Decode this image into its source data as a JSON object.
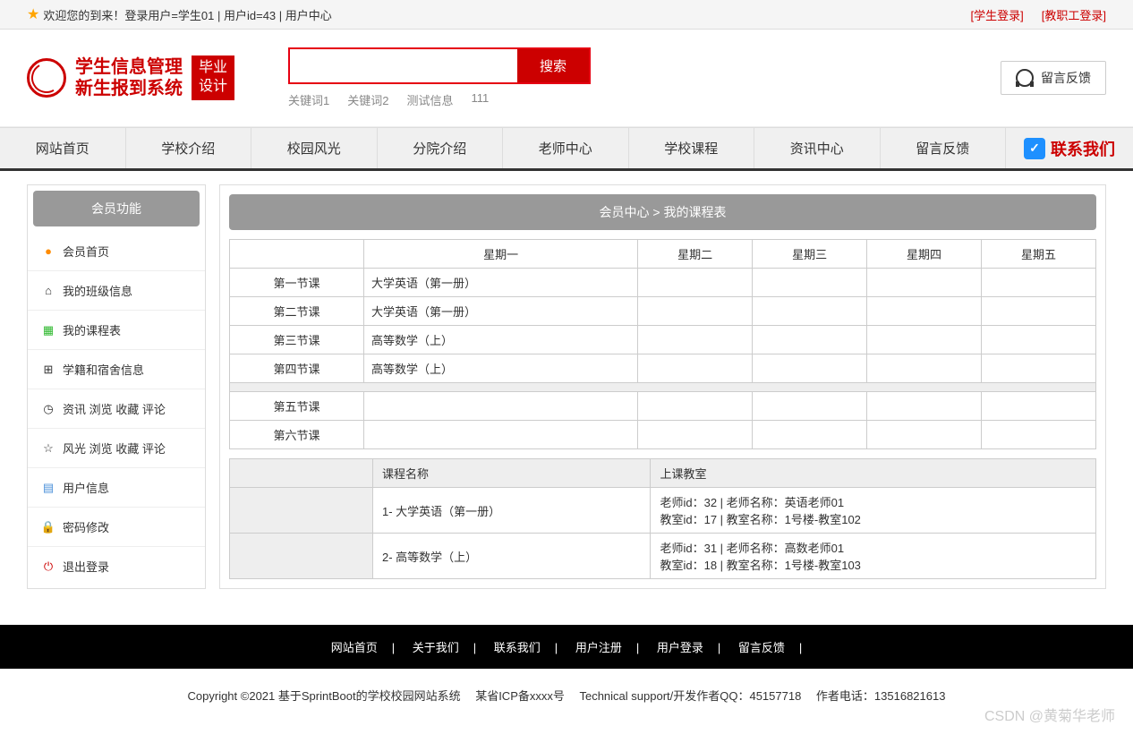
{
  "topBar": {
    "welcome": "欢迎您的到来！登录用户=学生01 | 用户id=43 | 用户中心",
    "studentLogin": "[学生登录]",
    "staffLogin": "[教职工登录]"
  },
  "header": {
    "logoLine1": "学生信息管理",
    "logoLine2": "新生报到系统",
    "badge1": "毕业",
    "badge2": "设计",
    "searchBtn": "搜索",
    "keywords": [
      "关键词1",
      "关键词2",
      "测试信息",
      "111"
    ],
    "feedbackBtn": "留言反馈"
  },
  "nav": {
    "items": [
      "网站首页",
      "学校介绍",
      "校园风光",
      "分院介绍",
      "老师中心",
      "学校课程",
      "资讯中心",
      "留言反馈"
    ],
    "contact": "联系我们"
  },
  "sidebar": {
    "title": "会员功能",
    "items": [
      {
        "label": "会员首页",
        "icon": "●",
        "cls": "icon-orange"
      },
      {
        "label": "我的班级信息",
        "icon": "⌂",
        "cls": ""
      },
      {
        "label": "我的课程表",
        "icon": "▦",
        "cls": "icon-green"
      },
      {
        "label": "学籍和宿舍信息",
        "icon": "⊞",
        "cls": ""
      },
      {
        "label": "资讯 浏览 收藏 评论",
        "icon": "◷",
        "cls": ""
      },
      {
        "label": "风光 浏览 收藏 评论",
        "icon": "☆",
        "cls": ""
      },
      {
        "label": "用户信息",
        "icon": "▤",
        "cls": "icon-blue"
      },
      {
        "label": "密码修改",
        "icon": "🔒",
        "cls": "icon-orange"
      },
      {
        "label": "退出登录",
        "icon": "⏻",
        "cls": "icon-red"
      }
    ]
  },
  "content": {
    "breadcrumb": "会员中心 > 我的课程表",
    "days": [
      "星期一",
      "星期二",
      "星期三",
      "星期四",
      "星期五"
    ],
    "periods": [
      {
        "name": "第一节课",
        "mon": "大学英语（第一册）"
      },
      {
        "name": "第二节课",
        "mon": "大学英语（第一册）"
      },
      {
        "name": "第三节课",
        "mon": "高等数学（上）"
      },
      {
        "name": "第四节课",
        "mon": "高等数学（上）"
      }
    ],
    "periods2": [
      {
        "name": "第五节课"
      },
      {
        "name": "第六节课"
      }
    ],
    "courseHeader": {
      "name": "课程名称",
      "room": "上课教室"
    },
    "courses": [
      {
        "name": "1- 大学英语（第一册）",
        "teacher": "老师id：32 | 老师名称：英语老师01",
        "room": "教室id：17 | 教室名称：1号楼-教室102"
      },
      {
        "name": "2- 高等数学（上）",
        "teacher": "老师id：31 | 老师名称：高数老师01",
        "room": "教室id：18 | 教室名称：1号楼-教室103"
      }
    ]
  },
  "footer": {
    "links": [
      "网站首页",
      "关于我们",
      "联系我们",
      "用户注册",
      "用户登录",
      "留言反馈"
    ],
    "copyright": "Copyright ©2021 基于SprintBoot的学校校园网站系统　 某省ICP备xxxx号　 Technical support/开发作者QQ：45157718　 作者电话：13516821613"
  },
  "watermark": "CSDN @黄菊华老师"
}
